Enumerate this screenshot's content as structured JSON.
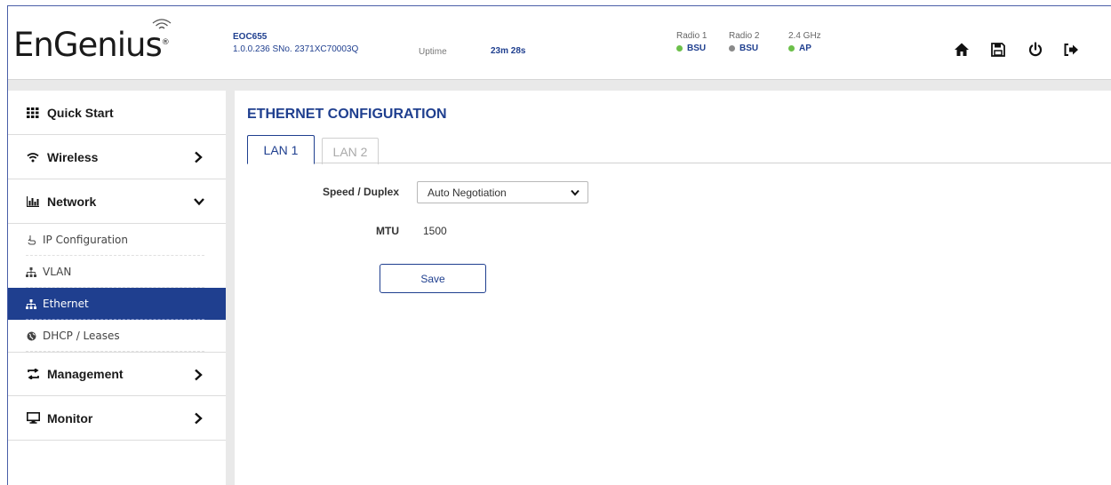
{
  "header": {
    "brand": "EnGenius",
    "brand_mark": "®",
    "device_model": "EOC655",
    "device_info": "1.0.0.236 SNo. 2371XC70003Q",
    "uptime_label": "Uptime",
    "uptime_value": "23m 28s",
    "radios": [
      {
        "label": "Radio 1",
        "status": "BSU",
        "dot_color": "#6cc04a"
      },
      {
        "label": "Radio 2",
        "status": "BSU",
        "dot_color": "#8a8a8a"
      },
      {
        "label": "2.4 GHz",
        "status": "AP",
        "dot_color": "#6cc04a"
      }
    ],
    "icons": [
      "home-icon",
      "save-disk-icon",
      "power-icon",
      "logout-icon"
    ]
  },
  "sidebar": {
    "quick_start": "Quick Start",
    "wireless": "Wireless",
    "network": "Network",
    "network_items": [
      "IP Configuration",
      "VLAN",
      "Ethernet",
      "DHCP / Leases"
    ],
    "active_item": "Ethernet",
    "management": "Management",
    "monitor": "Monitor"
  },
  "main": {
    "title": "ETHERNET CONFIGURATION",
    "tabs": [
      {
        "label": "LAN 1",
        "active": true
      },
      {
        "label": "LAN 2",
        "active": false
      }
    ],
    "speed_label": "Speed / Duplex",
    "speed_value": "Auto Negotiation",
    "mtu_label": "MTU",
    "mtu_value": "1500",
    "save_label": "Save"
  },
  "colors": {
    "accent": "#1f3f8f",
    "active_bg": "#1f3f8f",
    "status_green": "#6cc04a",
    "status_gray": "#8a8a8a"
  }
}
